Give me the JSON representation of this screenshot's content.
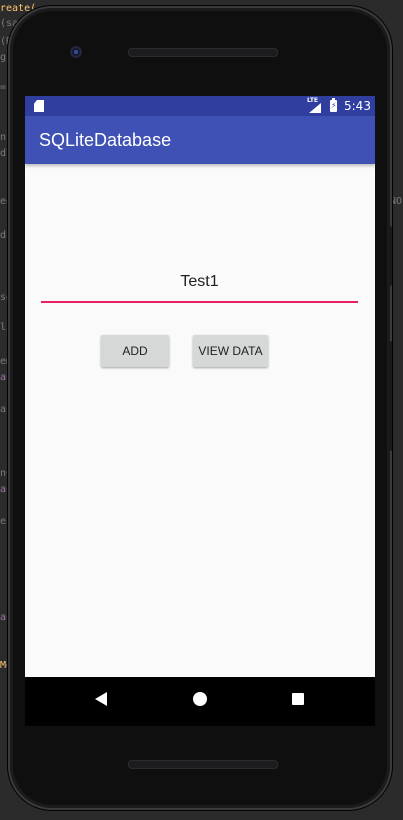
{
  "status_bar": {
    "time": "5:43",
    "network_label": "LTE"
  },
  "app_bar": {
    "title": "SQLiteDatabase"
  },
  "main": {
    "input": {
      "value": "Test1"
    },
    "buttons": {
      "add_label": "ADD",
      "view_label": "VIEW DATA"
    }
  },
  "colors": {
    "status_bar": "#303f9f",
    "app_bar": "#3f51b5",
    "accent_underline": "#e91e63",
    "button_bg": "#d6d7d7",
    "content_bg": "#fafafa"
  },
  "icons": [
    "sd-card-icon",
    "lte-signal-icon",
    "battery-charging-icon",
    "nav-back-icon",
    "nav-home-icon",
    "nav-recents-icon"
  ]
}
